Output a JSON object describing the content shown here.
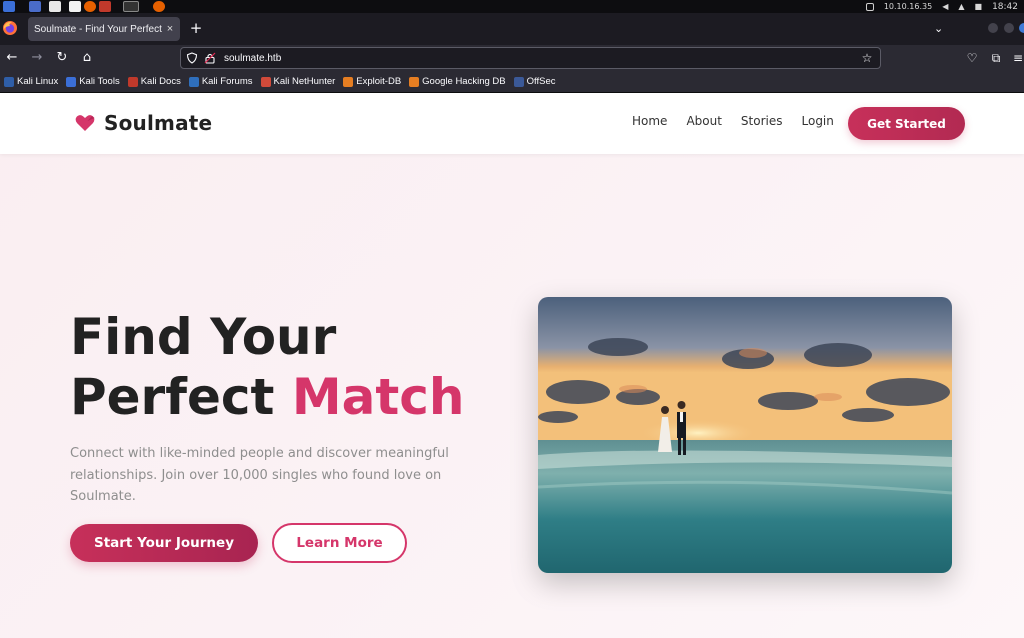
{
  "os": {
    "ip": "10.10.16.35",
    "time": "18:42"
  },
  "browser": {
    "tab_title": "Soulmate - Find Your Perfect Match",
    "tab_close": "×",
    "new_tab": "+",
    "url": "soulmate.htb"
  },
  "bookmarks": [
    {
      "label": "Kali Linux",
      "color": "#2f5ea8"
    },
    {
      "label": "Kali Tools",
      "color": "#3b6fd8"
    },
    {
      "label": "Kali Docs",
      "color": "#c0392b"
    },
    {
      "label": "Kali Forums",
      "color": "#2f6fbd"
    },
    {
      "label": "Kali NetHunter",
      "color": "#d04a3a"
    },
    {
      "label": "Exploit-DB",
      "color": "#e67e22"
    },
    {
      "label": "Google Hacking DB",
      "color": "#e67e22"
    },
    {
      "label": "OffSec",
      "color": "#3b5998"
    }
  ],
  "site": {
    "brand": "Soulmate",
    "nav": [
      "Home",
      "About",
      "Stories",
      "Login"
    ],
    "cta": "Get Started",
    "accent_color": "#d5366a"
  },
  "hero": {
    "title_line1": "Find Your",
    "title_line2_plain": "Perfect ",
    "title_line2_accent": "Match",
    "description": "Connect with like-minded people and discover meaningful relationships. Join over 10,000 singles who found love on Soulmate.",
    "primary_button": "Start Your Journey",
    "secondary_button": "Learn More"
  }
}
